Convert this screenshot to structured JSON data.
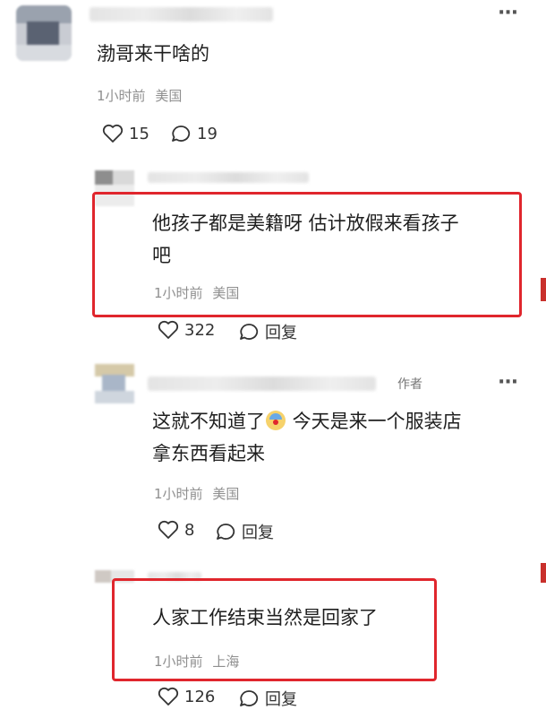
{
  "comments": [
    {
      "text": "渤哥来干啥的",
      "time": "1小时前",
      "location": "美国",
      "likes": "15",
      "replies": "19"
    },
    {
      "text_line1": "他孩子都是美籍呀 估计放假来看孩子",
      "text_line2": "吧",
      "time": "1小时前",
      "location": "美国",
      "likes": "322",
      "reply_label": "回复"
    },
    {
      "author_tag": "作者",
      "text_line1_a": "这就不知道了",
      "text_line1_b": " 今天是来一个服装店",
      "text_line2": "拿东西看起来",
      "time": "1小时前",
      "location": "美国",
      "likes": "8",
      "reply_label": "回复"
    },
    {
      "text": "人家工作结束当然是回家了",
      "time": "1小时前",
      "location": "上海",
      "likes": "126",
      "reply_label": "回复"
    }
  ],
  "icons": {
    "more": "more-dots-icon",
    "like": "heart-icon",
    "comment": "comment-bubble-icon",
    "emoji": "clown-face-emoji"
  },
  "colors": {
    "highlight": "#e0262d",
    "meta": "#8f8f8f"
  }
}
